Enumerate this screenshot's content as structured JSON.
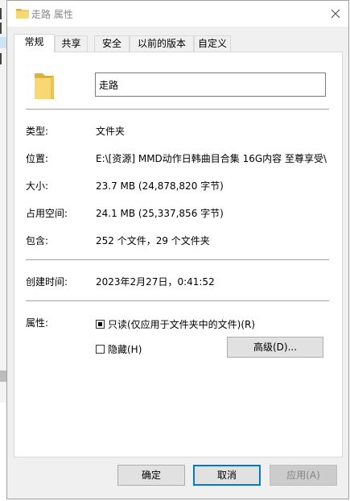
{
  "window": {
    "title": "走路 属性",
    "close_icon": "close-icon"
  },
  "tabs": [
    {
      "label": "常规",
      "active": true
    },
    {
      "label": "共享"
    },
    {
      "label": "安全"
    },
    {
      "label": "以前的版本"
    },
    {
      "label": "自定义"
    }
  ],
  "general": {
    "name_value": "走路",
    "type_label": "类型:",
    "type_value": "文件夹",
    "location_label": "位置:",
    "location_value": "E:\\[资源] MMD动作日韩曲目合集 16G内容 至尊享受\\",
    "size_label": "大小:",
    "size_value": "23.7 MB (24,878,820 字节)",
    "size_on_disk_label": "占用空间:",
    "size_on_disk_value": "24.1 MB (25,337,856 字节)",
    "contains_label": "包含:",
    "contains_value": "252 个文件，29 个文件夹",
    "created_label": "创建时间:",
    "created_value": "2023年2月27日，0:41:52",
    "attributes_label": "属性:",
    "readonly_label": "只读(仅应用于文件夹中的文件)(R)",
    "readonly_state": "indeterminate",
    "hidden_label": "隐藏(H)",
    "hidden_state": "unchecked",
    "advanced_label": "高级(D)..."
  },
  "footer": {
    "ok_label": "确定",
    "cancel_label": "取消",
    "apply_label": "应用(A)"
  },
  "colors": {
    "folder_yellow": "#f8d775",
    "folder_dark": "#dcb23f",
    "focus_blue": "#0078d7"
  }
}
